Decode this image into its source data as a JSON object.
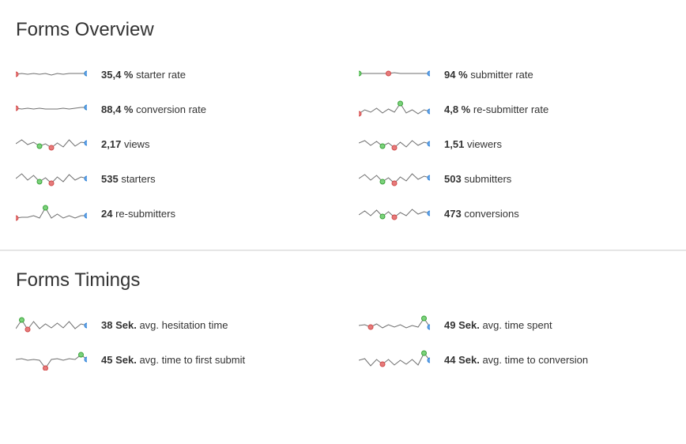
{
  "sections": {
    "overview_title": "Forms Overview",
    "timings_title": "Forms Timings"
  },
  "overview": [
    {
      "value": "35,4 %",
      "label": "starter rate",
      "spark": {
        "ys": [
          14,
          13,
          14,
          13,
          14,
          13,
          15,
          13,
          14,
          13,
          13,
          13,
          13
        ],
        "min": 0,
        "max": 12
      }
    },
    {
      "value": "94 %",
      "label": "submitter rate",
      "spark": {
        "ys": [
          13,
          13,
          13,
          13,
          13,
          13,
          12,
          13,
          13,
          13,
          13,
          13,
          13
        ],
        "min": 5,
        "max": 0
      }
    },
    {
      "value": "88,4 %",
      "label": "conversion rate",
      "spark": {
        "ys": [
          13,
          14,
          13,
          14,
          13,
          14,
          14,
          14,
          13,
          14,
          13,
          12,
          12
        ],
        "min": 0,
        "max": 12
      }
    },
    {
      "value": "4,8 %",
      "label": "re-submitter rate",
      "spark": {
        "ys": [
          20,
          15,
          18,
          13,
          19,
          14,
          18,
          7,
          19,
          15,
          20,
          15,
          17
        ],
        "min": 0,
        "max": 7
      }
    },
    {
      "value": "2,17",
      "label": "views",
      "spark": {
        "ys": [
          14,
          9,
          15,
          12,
          17,
          14,
          19,
          13,
          18,
          9,
          17,
          12,
          13
        ],
        "min": 6,
        "max": 4
      }
    },
    {
      "value": "1,51",
      "label": "viewers",
      "spark": {
        "ys": [
          13,
          10,
          16,
          11,
          17,
          13,
          19,
          12,
          18,
          10,
          16,
          12,
          14
        ],
        "min": 6,
        "max": 4
      }
    },
    {
      "value": "535",
      "label": "starters",
      "spark": {
        "ys": [
          14,
          8,
          16,
          10,
          18,
          13,
          20,
          12,
          18,
          9,
          16,
          12,
          14
        ],
        "min": 6,
        "max": 4
      }
    },
    {
      "value": "503",
      "label": "submitters",
      "spark": {
        "ys": [
          14,
          9,
          16,
          10,
          18,
          13,
          20,
          12,
          17,
          8,
          15,
          11,
          13
        ],
        "min": 6,
        "max": 4
      }
    },
    {
      "value": "24",
      "label": "re-submitters",
      "spark": {
        "ys": [
          20,
          19,
          19,
          17,
          20,
          7,
          20,
          15,
          20,
          17,
          20,
          17,
          17
        ],
        "min": 0,
        "max": 5
      }
    },
    {
      "value": "473",
      "label": "conversions",
      "spark": {
        "ys": [
          16,
          11,
          17,
          10,
          18,
          12,
          19,
          13,
          17,
          9,
          15,
          12,
          14
        ],
        "min": 6,
        "max": 4
      }
    }
  ],
  "timings": [
    {
      "value": "38 Sek.",
      "label": "avg. hesitation time",
      "spark": {
        "ys": [
          19,
          8,
          20,
          10,
          19,
          13,
          18,
          12,
          18,
          10,
          19,
          13,
          15
        ],
        "min": 2,
        "max": 1
      }
    },
    {
      "value": "49 Sek.",
      "label": "avg. time spent",
      "spark": {
        "ys": [
          15,
          14,
          17,
          13,
          18,
          14,
          17,
          14,
          18,
          15,
          17,
          6,
          17
        ],
        "min": 2,
        "max": 11
      }
    },
    {
      "value": "45 Sek.",
      "label": "avg. time to first submit",
      "spark": {
        "ys": [
          14,
          13,
          15,
          14,
          15,
          25,
          14,
          13,
          15,
          13,
          14,
          8,
          14
        ],
        "min": 5,
        "max": 11
      }
    },
    {
      "value": "44 Sek.",
      "label": "avg. time to conversion",
      "spark": {
        "ys": [
          15,
          13,
          22,
          14,
          20,
          14,
          21,
          15,
          20,
          14,
          21,
          6,
          15
        ],
        "min": 4,
        "max": 11
      }
    }
  ],
  "chart_data": [
    {
      "type": "line",
      "title": "starter rate sparkline",
      "values": [
        14,
        13,
        14,
        13,
        14,
        13,
        15,
        13,
        14,
        13,
        13,
        13,
        13
      ]
    },
    {
      "type": "line",
      "title": "submitter rate sparkline",
      "values": [
        13,
        13,
        13,
        13,
        13,
        13,
        12,
        13,
        13,
        13,
        13,
        13,
        13
      ]
    },
    {
      "type": "line",
      "title": "conversion rate sparkline",
      "values": [
        13,
        14,
        13,
        14,
        13,
        14,
        14,
        14,
        13,
        14,
        13,
        12,
        12
      ]
    },
    {
      "type": "line",
      "title": "re-submitter rate sparkline",
      "values": [
        20,
        15,
        18,
        13,
        19,
        14,
        18,
        7,
        19,
        15,
        20,
        15,
        17
      ]
    },
    {
      "type": "line",
      "title": "views sparkline",
      "values": [
        14,
        9,
        15,
        12,
        17,
        14,
        19,
        13,
        18,
        9,
        17,
        12,
        13
      ]
    },
    {
      "type": "line",
      "title": "viewers sparkline",
      "values": [
        13,
        10,
        16,
        11,
        17,
        13,
        19,
        12,
        18,
        10,
        16,
        12,
        14
      ]
    },
    {
      "type": "line",
      "title": "starters sparkline",
      "values": [
        14,
        8,
        16,
        10,
        18,
        13,
        20,
        12,
        18,
        9,
        16,
        12,
        14
      ]
    },
    {
      "type": "line",
      "title": "submitters sparkline",
      "values": [
        14,
        9,
        16,
        10,
        18,
        13,
        20,
        12,
        17,
        8,
        15,
        11,
        13
      ]
    },
    {
      "type": "line",
      "title": "re-submitters sparkline",
      "values": [
        20,
        19,
        19,
        17,
        20,
        7,
        20,
        15,
        20,
        17,
        20,
        17,
        17
      ]
    },
    {
      "type": "line",
      "title": "conversions sparkline",
      "values": [
        16,
        11,
        17,
        10,
        18,
        12,
        19,
        13,
        17,
        9,
        15,
        12,
        14
      ]
    },
    {
      "type": "line",
      "title": "avg. hesitation time sparkline",
      "values": [
        19,
        8,
        20,
        10,
        19,
        13,
        18,
        12,
        18,
        10,
        19,
        13,
        15
      ]
    },
    {
      "type": "line",
      "title": "avg. time spent sparkline",
      "values": [
        15,
        14,
        17,
        13,
        18,
        14,
        17,
        14,
        18,
        15,
        17,
        6,
        17
      ]
    },
    {
      "type": "line",
      "title": "avg. time to first submit sparkline",
      "values": [
        14,
        13,
        15,
        14,
        15,
        25,
        14,
        13,
        15,
        13,
        14,
        8,
        14
      ]
    },
    {
      "type": "line",
      "title": "avg. time to conversion sparkline",
      "values": [
        15,
        13,
        22,
        14,
        20,
        14,
        21,
        15,
        20,
        14,
        21,
        6,
        15
      ]
    }
  ]
}
